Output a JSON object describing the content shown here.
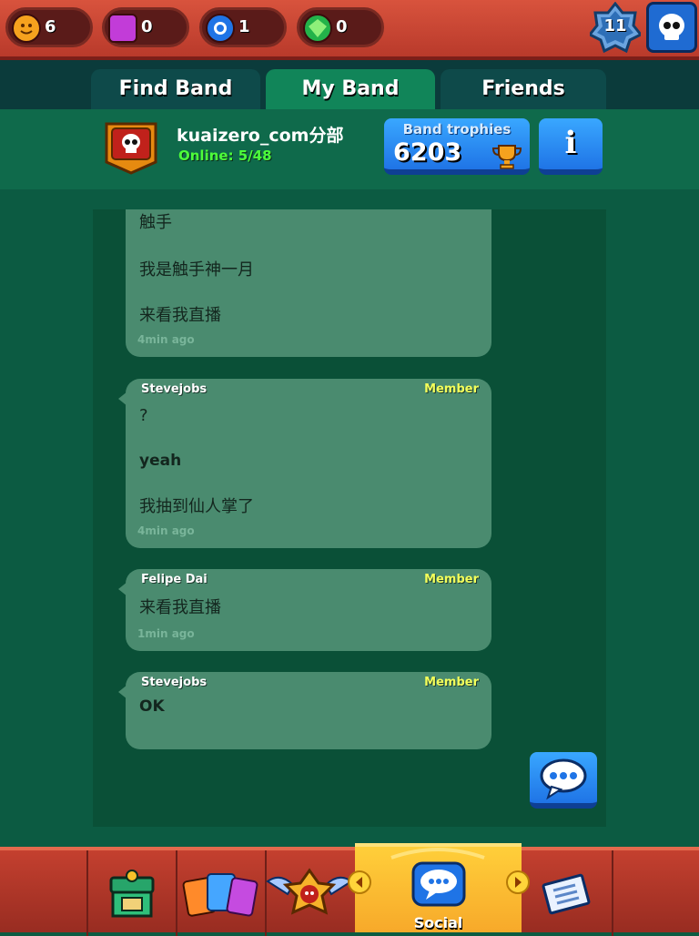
{
  "resources": [
    {
      "name": "trophies",
      "value": "6"
    },
    {
      "name": "power-points",
      "value": "0"
    },
    {
      "name": "tokens",
      "value": "1"
    },
    {
      "name": "gems",
      "value": "0"
    }
  ],
  "level": "11",
  "tabs": [
    "Find Band",
    "My Band",
    "Friends"
  ],
  "band": {
    "name": "kuaizero_com分部",
    "online": "Online: 5/48",
    "trophies_label": "Band trophies",
    "trophies": "6203",
    "info_label": "i"
  },
  "messages": [
    {
      "sender": "",
      "role": "",
      "lines": [
        "触手",
        "我是触手神一月",
        "来看我直播"
      ],
      "time": "4min ago"
    },
    {
      "sender": "Stevejobs",
      "role": "Member",
      "lines": [
        "?",
        "yeah",
        "我抽到仙人掌了"
      ],
      "time": "4min ago"
    },
    {
      "sender": "Felipe Dai",
      "role": "Member",
      "lines": [
        "来看我直播"
      ],
      "time": "1min ago"
    },
    {
      "sender": "Stevejobs",
      "role": "Member",
      "lines": [
        "OK"
      ],
      "time": ""
    }
  ],
  "nav": {
    "social_label": "Social"
  },
  "colors": {
    "accent_blue": "#1f74e6",
    "online_green": "#4dff3a",
    "member_yellow": "#f3ff5a"
  }
}
